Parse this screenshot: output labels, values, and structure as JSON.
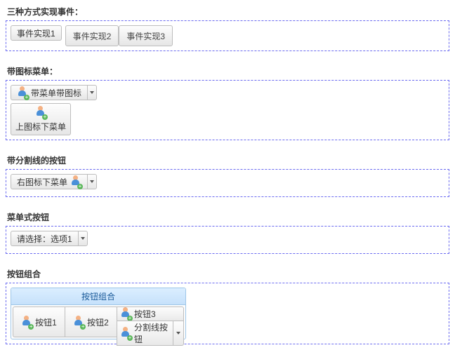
{
  "sections": {
    "s1": {
      "title": "三种方式实现事件：",
      "btn1": "事件实现1",
      "btn2": "事件实现2",
      "btn3": "事件实现3"
    },
    "s2": {
      "title": "带图标菜单：",
      "menu_with_icon": "带菜单带图标",
      "icon_top_menu_bottom": "上图标下菜单"
    },
    "s3": {
      "title": "带分割线的按钮",
      "btn": "右图标下菜单"
    },
    "s4": {
      "title": "菜单式按钮",
      "btn": "请选择：选项1"
    },
    "s5": {
      "title": "按钮组合",
      "group_header": "按钮组合",
      "b1": "按钮1",
      "b2": "按钮2",
      "b3": "按钮3",
      "b4": "分割线按钮"
    }
  }
}
